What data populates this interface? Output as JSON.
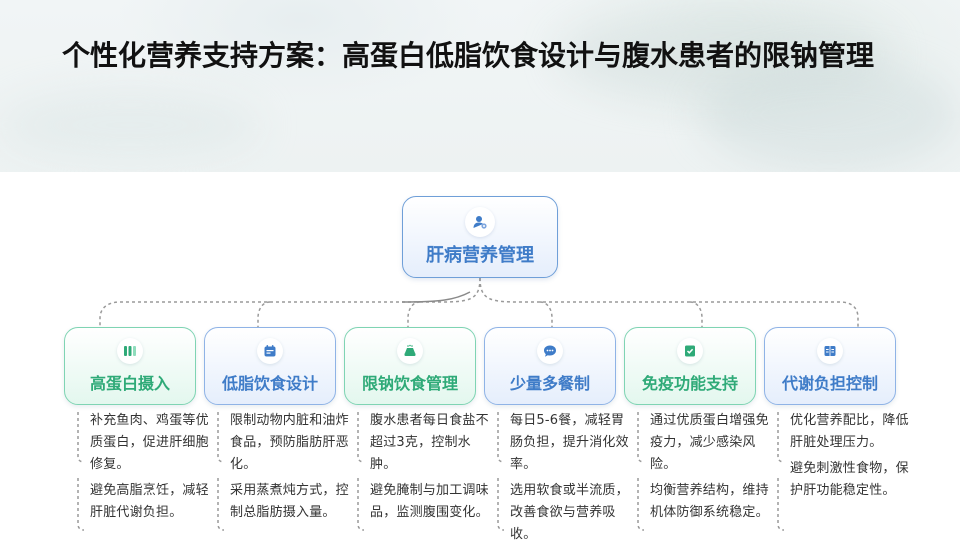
{
  "title": "个性化营养支持方案：高蛋白低脂饮食设计与腹水患者的限钠管理",
  "colors": {
    "green_accent": "#2faa78",
    "blue_accent": "#3f7cc8",
    "connector": "#9a9a9a"
  },
  "root": {
    "label": "肝病营养管理",
    "icon": "user-gear-icon"
  },
  "branches": [
    {
      "label": "高蛋白摄入",
      "icon": "nutrition-bars-icon",
      "theme": "green",
      "notes": [
        "补充鱼肉、鸡蛋等优质蛋白，促进肝细胞修复。",
        "避免高脂烹饪，减轻肝脏代谢负担。"
      ]
    },
    {
      "label": "低脂饮食设计",
      "icon": "calendar-icon",
      "theme": "blue",
      "notes": [
        "限制动物内脏和油炸食品，预防脂肪肝恶化。",
        "采用蒸煮炖方式，控制总脂肪摄入量。"
      ]
    },
    {
      "label": "限钠饮食管理",
      "icon": "salt-shaker-icon",
      "theme": "green",
      "notes": [
        "腹水患者每日食盐不超过3克，控制水肿。",
        "避免腌制与加工调味品，监测腹围变化。"
      ]
    },
    {
      "label": "少量多餐制",
      "icon": "chat-bubble-icon",
      "theme": "blue",
      "notes": [
        "每日5-6餐，减轻胃肠负担，提升消化效率。",
        "选用软食或半流质，改善食欲与营养吸收。"
      ]
    },
    {
      "label": "免疫功能支持",
      "icon": "clipboard-check-icon",
      "theme": "green",
      "notes": [
        "通过优质蛋白增强免疫力，减少感染风险。",
        "均衡营养结构，维持机体防御系统稳定。"
      ]
    },
    {
      "label": "代谢负担控制",
      "icon": "ledger-icon",
      "theme": "blue",
      "notes": [
        "优化营养配比，降低肝脏处理压力。",
        "避免刺激性食物，保护肝功能稳定性。"
      ]
    }
  ]
}
